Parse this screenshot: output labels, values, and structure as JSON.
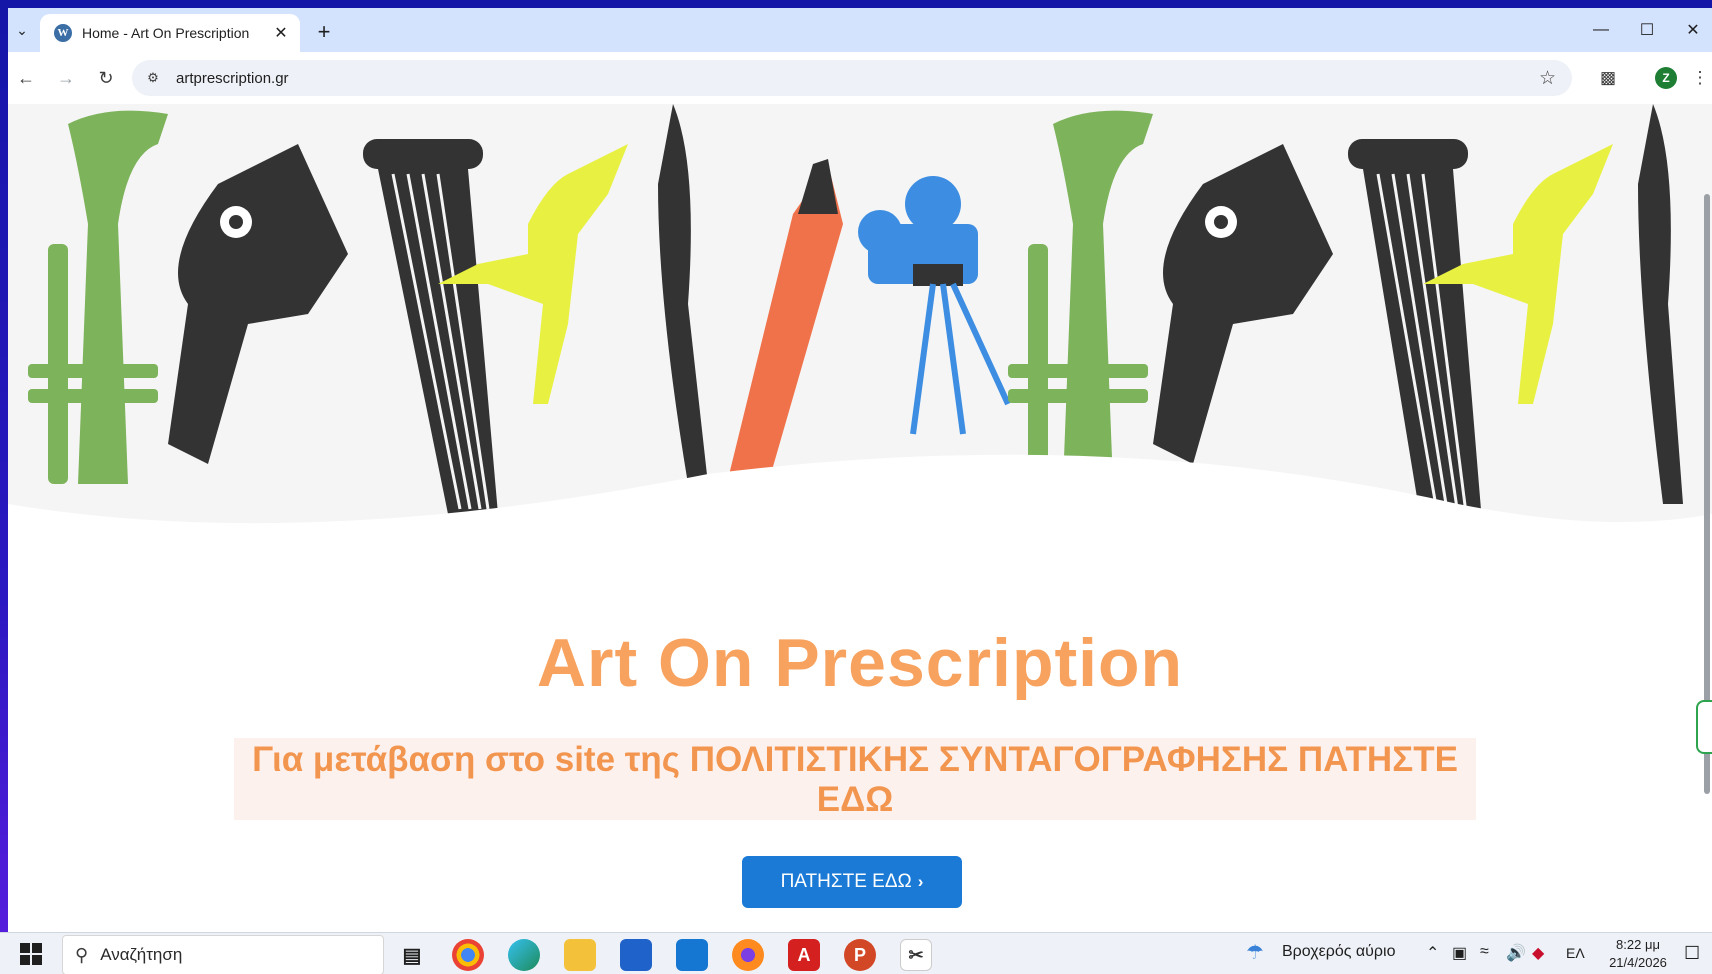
{
  "browser": {
    "tab": {
      "title": "Home - Art On Prescription",
      "favicon": "wordpress-icon"
    },
    "omnibox": {
      "url": "artprescription.gr"
    },
    "profile_initial": "Z"
  },
  "page": {
    "banner": {
      "alt_theme": "arts-illustration"
    },
    "headline": "Art On Prescription",
    "notice": "Για μετάβαση στο site της ΠΟΛΙΤΙΣΤΙΚΗΣ ΣΥΝΤΑΓΟΓΡΑΦΗΣΗΣ ΠΑΤΗΣΤΕ ΕΔΩ",
    "cta_label": "ΠΑΤΗΣΤΕ ΕΔΩ",
    "colors": {
      "accent": "#f7a25e",
      "button": "#1a7ad6",
      "notice_bg": "#fdf1ee"
    }
  },
  "taskbar": {
    "search_placeholder": "Αναζήτηση",
    "weather": "Βροχερός αύριο",
    "language": "ΕΛ",
    "time": "8:22 μμ",
    "date": "21/4/2026",
    "apps": [
      "task-view-icon",
      "chrome-icon",
      "edge-icon",
      "file-explorer-icon",
      "store-icon",
      "outlook-icon",
      "firefox-icon",
      "acrobat-icon",
      "powerpoint-icon",
      "snipping-tool-icon"
    ]
  }
}
